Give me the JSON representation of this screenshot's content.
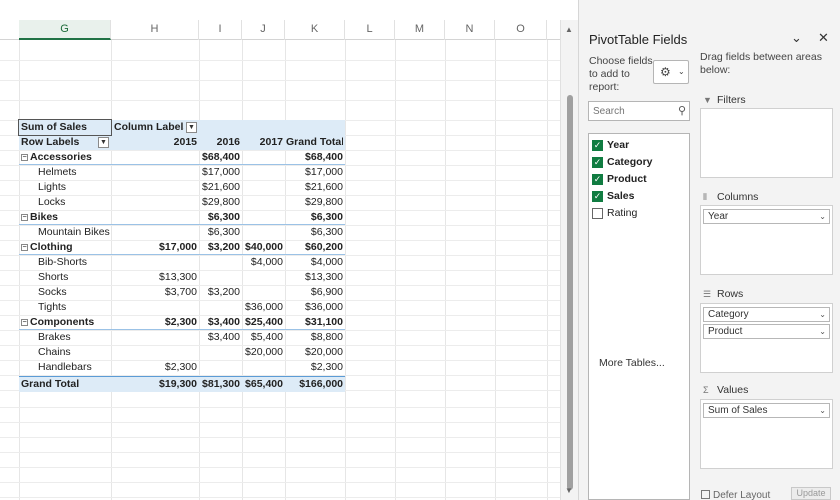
{
  "sheet": {
    "columns": [
      "G",
      "H",
      "I",
      "J",
      "K",
      "L",
      "M",
      "N",
      "O"
    ],
    "pivot": {
      "values_field": "Sum of Sales",
      "column_labels": "Column Labels",
      "row_labels": "Row Labels",
      "year_headers": [
        "2015",
        "2016",
        "2017",
        "Grand Total"
      ],
      "rows": [
        {
          "label": "Accessories",
          "level": 0,
          "v2015": "",
          "v2016": "$68,400",
          "v2017": "",
          "total": "$68,400"
        },
        {
          "label": "Helmets",
          "level": 1,
          "v2015": "",
          "v2016": "$17,000",
          "v2017": "",
          "total": "$17,000"
        },
        {
          "label": "Lights",
          "level": 1,
          "v2015": "",
          "v2016": "$21,600",
          "v2017": "",
          "total": "$21,600"
        },
        {
          "label": "Locks",
          "level": 1,
          "v2015": "",
          "v2016": "$29,800",
          "v2017": "",
          "total": "$29,800"
        },
        {
          "label": "Bikes",
          "level": 0,
          "v2015": "",
          "v2016": "$6,300",
          "v2017": "",
          "total": "$6,300"
        },
        {
          "label": "Mountain Bikes",
          "level": 1,
          "v2015": "",
          "v2016": "$6,300",
          "v2017": "",
          "total": "$6,300"
        },
        {
          "label": "Clothing",
          "level": 0,
          "v2015": "$17,000",
          "v2016": "$3,200",
          "v2017": "$40,000",
          "total": "$60,200"
        },
        {
          "label": "Bib-Shorts",
          "level": 1,
          "v2015": "",
          "v2016": "",
          "v2017": "$4,000",
          "total": "$4,000"
        },
        {
          "label": "Shorts",
          "level": 1,
          "v2015": "$13,300",
          "v2016": "",
          "v2017": "",
          "total": "$13,300"
        },
        {
          "label": "Socks",
          "level": 1,
          "v2015": "$3,700",
          "v2016": "$3,200",
          "v2017": "",
          "total": "$6,900"
        },
        {
          "label": "Tights",
          "level": 1,
          "v2015": "",
          "v2016": "",
          "v2017": "$36,000",
          "total": "$36,000"
        },
        {
          "label": "Components",
          "level": 0,
          "v2015": "$2,300",
          "v2016": "$3,400",
          "v2017": "$25,400",
          "total": "$31,100"
        },
        {
          "label": "Brakes",
          "level": 1,
          "v2015": "",
          "v2016": "$3,400",
          "v2017": "$5,400",
          "total": "$8,800"
        },
        {
          "label": "Chains",
          "level": 1,
          "v2015": "",
          "v2016": "",
          "v2017": "$20,000",
          "total": "$20,000"
        },
        {
          "label": "Handlebars",
          "level": 1,
          "v2015": "$2,300",
          "v2016": "",
          "v2017": "",
          "total": "$2,300"
        }
      ],
      "grand_total": {
        "label": "Grand Total",
        "v2015": "$19,300",
        "v2016": "$81,300",
        "v2017": "$65,400",
        "total": "$166,000"
      }
    }
  },
  "pane": {
    "title": "PivotTable Fields",
    "choose_text": "Choose fields to add to report:",
    "search_placeholder": "Search",
    "fields": [
      {
        "name": "Year",
        "checked": true
      },
      {
        "name": "Category",
        "checked": true
      },
      {
        "name": "Product",
        "checked": true
      },
      {
        "name": "Sales",
        "checked": true
      },
      {
        "name": "Rating",
        "checked": false
      }
    ],
    "more_tables": "More Tables...",
    "drag_hint": "Drag fields between areas below:",
    "areas": {
      "filters": {
        "label": "Filters",
        "items": []
      },
      "columns": {
        "label": "Columns",
        "items": [
          "Year"
        ]
      },
      "rows": {
        "label": "Rows",
        "items": [
          "Category",
          "Product"
        ]
      },
      "values": {
        "label": "Values",
        "items": [
          "Sum of Sales"
        ]
      }
    },
    "defer_label": "Defer Layout",
    "update_label": "Update"
  },
  "colors": {
    "header_band": "#ddebf7",
    "accent": "#217346",
    "checkbox": "#107c41"
  }
}
